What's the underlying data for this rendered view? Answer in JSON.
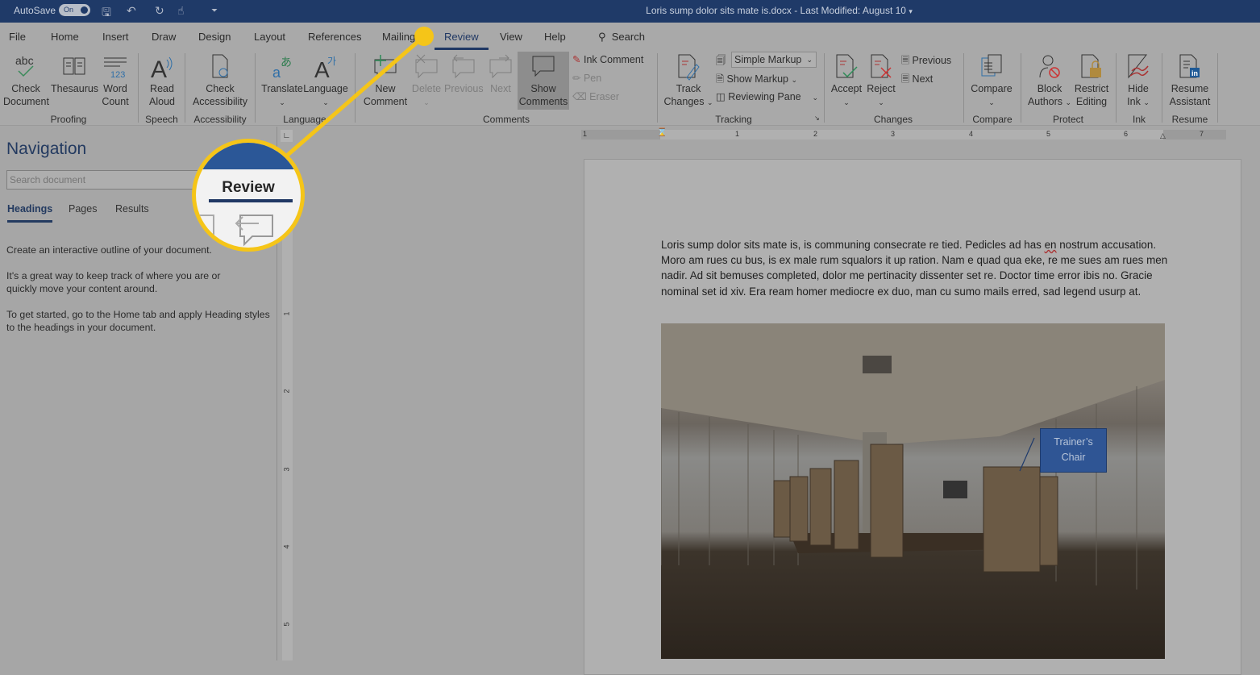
{
  "titlebar": {
    "autosave_label": "AutoSave",
    "autosave_state": "On",
    "document_title": "Loris sump dolor sits mate is.docx  -  Last Modified: August 10",
    "quick_access_icons": [
      "save-icon",
      "undo-icon",
      "redo-icon",
      "touch-mode-icon",
      "customize-icon"
    ]
  },
  "menu": {
    "tabs": [
      "File",
      "Home",
      "Insert",
      "Draw",
      "Design",
      "Layout",
      "References",
      "Mailings",
      "Review",
      "View",
      "Help"
    ],
    "active_tab": "Review",
    "search_label": "Search"
  },
  "ribbon": {
    "proofing": {
      "check_document": "Check Document",
      "thesaurus": "Thesaurus",
      "word_count": "Word Count",
      "label": "Proofing"
    },
    "speech": {
      "read_aloud": "Read Aloud",
      "label": "Speech"
    },
    "accessibility": {
      "check_accessibility": "Check Accessibility",
      "label": "Accessibility"
    },
    "language": {
      "translate": "Translate",
      "language": "Language",
      "label": "Language"
    },
    "comments": {
      "new_comment": "New Comment",
      "delete": "Delete",
      "previous": "Previous",
      "next": "Next",
      "show_comments": "Show Comments",
      "ink_comment": "Ink Comment",
      "pen": "Pen",
      "eraser": "Eraser",
      "label": "Comments"
    },
    "tracking": {
      "track_changes": "Track Changes",
      "markup_select": "Simple Markup",
      "show_markup": "Show Markup",
      "reviewing_pane": "Reviewing Pane",
      "label": "Tracking"
    },
    "changes": {
      "accept": "Accept",
      "reject": "Reject",
      "previous": "Previous",
      "next": "Next",
      "label": "Changes"
    },
    "compare": {
      "compare": "Compare",
      "label": "Compare"
    },
    "protect": {
      "block_authors": "Block Authors",
      "restrict_editing": "Restrict Editing",
      "label": "Protect"
    },
    "ink": {
      "hide_ink": "Hide Ink",
      "label": "Ink"
    },
    "resume": {
      "resume_assistant": "Resume Assistant",
      "label": "Resume"
    }
  },
  "navigation": {
    "title": "Navigation",
    "search_placeholder": "Search document",
    "tabs": [
      "Headings",
      "Pages",
      "Results"
    ],
    "active_tab": "Headings",
    "help_1": "Create an interactive outline of your document.",
    "help_2": "It's a great way to keep track of where you are or quickly move your content around.",
    "help_3": "To get started, go to the Home tab and apply Heading styles to the headings in your document."
  },
  "ruler": {
    "horizontal": [
      "1",
      "1",
      "2",
      "3",
      "4",
      "5",
      "6",
      "7"
    ],
    "vertical": [
      "1",
      "2",
      "3",
      "4",
      "5"
    ]
  },
  "document": {
    "paragraph_before": "Loris sump dolor sits mate is, is communing consecrate re tied. Pedicles ad has ",
    "misspelled": "en",
    "paragraph_after": " nostrum accusation. Moro am rues cu bus, is ex male rum squalors it up ration. Nam e quad qua eke, re me sues am rues men nadir. Ad sit bemuses completed, dolor me pertinacity dissenter set re. Doctor time error ibis no. Gracie nominal set id xiv. Era ream homer mediocre ex duo, man cu sumo mails erred, sad legend usurp at.",
    "image_alt": "Conference room with chairs and a long table",
    "callout": "Trainer’s Chair"
  },
  "magnifier": {
    "label": "Review"
  },
  "colors": {
    "title_bar": "#1f3a68",
    "accent": "#203864",
    "highlight": "#f5c518",
    "callout": "#2f5594"
  }
}
